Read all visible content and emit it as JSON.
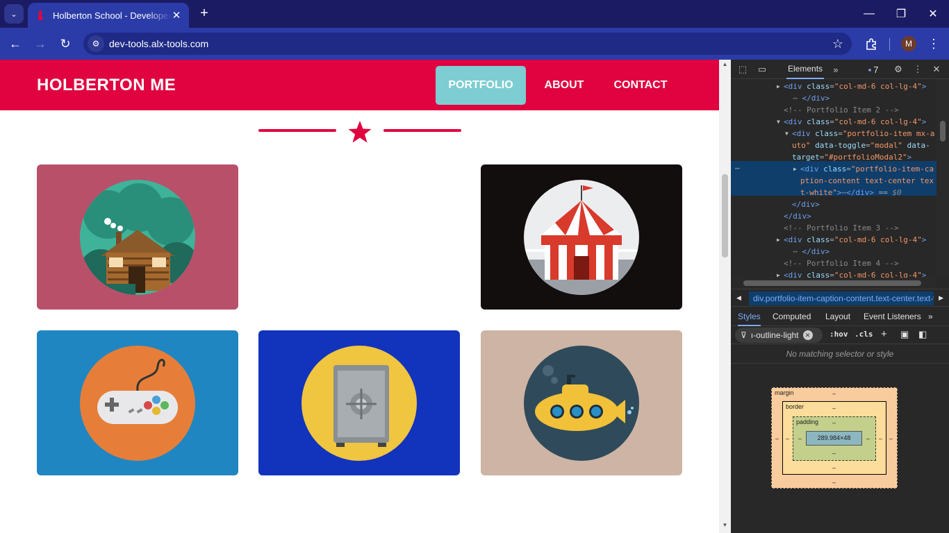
{
  "browser": {
    "tab_title": "Holberton School - Developer t",
    "url": "dev-tools.alx-tools.com",
    "profile_initial": "M"
  },
  "site": {
    "brand": "HOLBERTON ME",
    "nav": [
      "PORTFOLIO",
      "ABOUT",
      "CONTACT"
    ],
    "active_nav": "PORTFOLIO",
    "accent_color": "#e0033f",
    "portfolio": [
      {
        "name": "cabin",
        "background": "#b9506a"
      },
      {
        "name": "circus-tent",
        "background": "#130e0e"
      },
      {
        "name": "game-controller",
        "background": "#1f86c2"
      },
      {
        "name": "safe",
        "background": "#1233bc"
      },
      {
        "name": "submarine",
        "background": "#cdb4a4"
      }
    ]
  },
  "devtools": {
    "panel_tab": "Elements",
    "issues_count": "7",
    "dom_lines": [
      {
        "indent": 0,
        "html": "<span class='tg'>&lt;div</span> <span class='at'>class</span><span class='eq'>=</span><span class='av'>\"col-md-6 col-lg-4\"</span><span class='tg'>&gt;</span>"
      },
      {
        "indent": 0,
        "html": "  <span class='cm'>⋯</span> <span class='tg'>&lt;/div&gt;</span>"
      },
      {
        "indent": 0,
        "html": "<span class='cm'>&lt;!-- Portfolio Item 2 --&gt;</span>"
      },
      {
        "indent": 0,
        "html": "<span class='tg'>&lt;div</span> <span class='at'>class</span><span class='eq'>=</span><span class='av'>\"col-md-6 col-lg-4\"</span><span class='tg'>&gt;</span>"
      },
      {
        "indent": 1,
        "html": "<span class='tg'>&lt;div</span> <span class='at'>class</span><span class='eq'>=</span><span class='av'>\"portfolio-item mx-a</span>"
      },
      {
        "indent": 1,
        "html": "<span class='av'>uto\"</span> <span class='at'>data-toggle</span><span class='eq'>=</span><span class='av'>\"modal\"</span> <span class='at'>data-</span>"
      },
      {
        "indent": 1,
        "html": "<span class='at'>target</span><span class='eq'>=</span><span class='av'>\"#portfolioModal2\"</span><span class='tg'>&gt;</span>"
      },
      {
        "indent": 2,
        "html": "<span class='tg'>&lt;div</span> <span class='at'>class</span><span class='eq'>=</span><span class='av'>\"portfolio-item-ca</span>"
      },
      {
        "indent": 2,
        "html": "<span class='av'>ption-content text-center tex</span>"
      },
      {
        "indent": 2,
        "html": "<span class='av'>t-white\"</span><span class='tg'>&gt;</span><span class='cm'>⋯</span><span class='tg'>&lt;/div&gt;</span> <span class='eq'>==</span> <span class='cm'><i>$0</i></span>"
      },
      {
        "indent": 1,
        "html": "<span class='tg'>&lt;/div&gt;</span>"
      },
      {
        "indent": 0,
        "html": "<span class='tg'>&lt;/div&gt;</span>"
      },
      {
        "indent": 0,
        "html": "<span class='cm'>&lt;!-- Portfolio Item 3 --&gt;</span>"
      },
      {
        "indent": 0,
        "html": "<span class='tg'>&lt;div</span> <span class='at'>class</span><span class='eq'>=</span><span class='av'>\"col-md-6 col-lg-4\"</span><span class='tg'>&gt;</span>"
      },
      {
        "indent": 0,
        "html": "  <span class='cm'>⋯</span> <span class='tg'>&lt;/div&gt;</span>"
      },
      {
        "indent": 0,
        "html": "<span class='cm'>&lt;!-- Portfolio Item 4 --&gt;</span>"
      },
      {
        "indent": 0,
        "html": "<span class='tg'>&lt;div</span> <span class='at'>class</span><span class='eq'>=</span><span class='av'>\"col-md-6 col-lg-4\"</span><span class='tg'>&gt;</span>"
      }
    ],
    "breadcrumb": "div.portfolio-item-caption-content.text-center.text-white",
    "style_tabs": [
      "Styles",
      "Computed",
      "Layout",
      "Event Listeners"
    ],
    "filter_text": "ı-outline-light",
    "hov": ":hov",
    "cls": ".cls",
    "no_match": "No matching selector or style",
    "box_model": {
      "margin_label": "margin",
      "border_label": "border",
      "padding_label": "padding",
      "content_size": "289.984×48",
      "dash": "–"
    }
  }
}
